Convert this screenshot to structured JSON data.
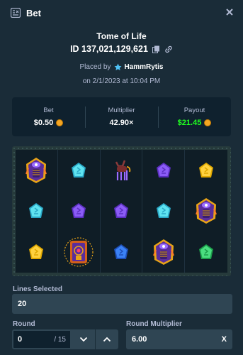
{
  "header": {
    "title": "Bet"
  },
  "game": {
    "name": "Tome of Life",
    "bet_id": "ID 137,021,129,621",
    "placed_by_label": "Placed by",
    "user": "HammRytis",
    "date": "on 2/1/2023 at 10:04 PM"
  },
  "stats": {
    "bet_label": "Bet",
    "bet_value": "$0.50",
    "multiplier_label": "Multiplier",
    "multiplier_value": "42.90×",
    "payout_label": "Payout",
    "payout_value": "$21.45"
  },
  "board": {
    "rows": [
      [
        "pharaoh",
        "cyan-rune",
        "jackal",
        "purple-rune",
        "yellow-rune"
      ],
      [
        "cyan-rune",
        "purple-rune",
        "purple-rune",
        "cyan-rune",
        "pharaoh"
      ],
      [
        "yellow-rune",
        "tome",
        "blue-rune",
        "pharaoh",
        "green-rune"
      ]
    ]
  },
  "lines": {
    "label": "Lines Selected",
    "value": "20"
  },
  "round": {
    "label": "Round",
    "value": "0",
    "total": "/ 15"
  },
  "round_multiplier": {
    "label": "Round Multiplier",
    "value": "6.00",
    "clear": "X"
  },
  "colors": {
    "background": "#1a2c38",
    "panel": "#0f212e",
    "input": "#2f4553",
    "payout": "#1fff20",
    "coin": "#f5a623"
  }
}
